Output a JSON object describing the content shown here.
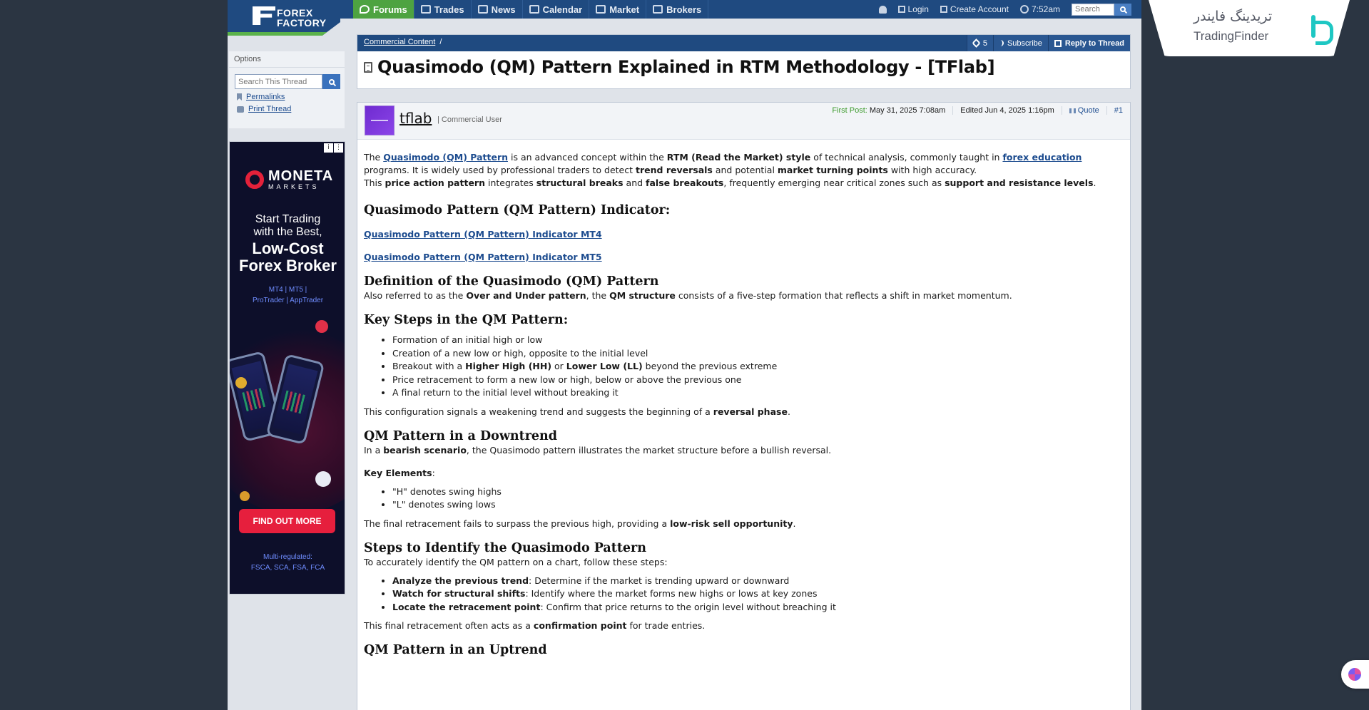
{
  "site": {
    "logo_line1": "FOREX",
    "logo_line2": "FACTORY"
  },
  "nav": {
    "tabs": [
      {
        "label": "Forums",
        "icon": "forums-icon",
        "active": true
      },
      {
        "label": "Trades",
        "icon": "trades-icon"
      },
      {
        "label": "News",
        "icon": "news-icon"
      },
      {
        "label": "Calendar",
        "icon": "calendar-icon"
      },
      {
        "label": "Market",
        "icon": "market-icon"
      },
      {
        "label": "Brokers",
        "icon": "brokers-icon"
      }
    ],
    "login": "Login",
    "create_account": "Create Account",
    "time": "7:52am",
    "search_placeholder": "Search"
  },
  "sidebar": {
    "options_title": "Options",
    "search_placeholder": "Search This Thread",
    "permalinks": "Permalinks",
    "print_thread": "Print Thread"
  },
  "ad": {
    "brand": "MONETA",
    "brand_sub": "MARKETS",
    "line1a": "Start Trading",
    "line1b": "with the Best,",
    "line2a": "Low-Cost",
    "line2b": "Forex Broker",
    "platforms1": "MT4 | MT5 |",
    "platforms2": "ProTrader | AppTrader",
    "cta": "FIND OUT MORE",
    "reg1": "Multi-regulated:",
    "reg2": "FSCA, SCA, FSA, FCA",
    "badge_info": "i",
    "badge_menu": "⋮"
  },
  "thread": {
    "breadcrumb": "Commercial Content",
    "breadcrumb_sep": "/",
    "tag_count": "5",
    "subscribe": "Subscribe",
    "reply": "Reply to Thread",
    "title": "Quasimodo (QM) Pattern Explained in RTM Methodology - [TFlab]"
  },
  "post": {
    "username": "tflab",
    "role_sep": "|",
    "role": "Commercial User",
    "first_post_label": "First Post:",
    "first_post_date": "May 31, 2025 7:08am",
    "edited": "Edited Jun 4, 2025 1:16pm",
    "quote": "Quote",
    "permalink_hash": "#",
    "permalink_num": "1",
    "intro": {
      "t1": "The ",
      "link1": "Quasimodo (QM) Pattern",
      "t2": " is an advanced concept within the ",
      "b1": "RTM (Read the Market) style",
      "t3": " of technical analysis, commonly taught in ",
      "link2": "forex education",
      "t4": " programs. It is widely used by professional traders to detect ",
      "b2": "trend reversals",
      "t5": " and potential ",
      "b3": "market turning points",
      "t6": " with high accuracy.",
      "t7": "This ",
      "b4": "price action pattern",
      "t8": " integrates ",
      "b5": "structural breaks",
      "t9": " and ",
      "b6": "false breakouts",
      "t10": ", frequently emerging near critical zones such as ",
      "b7": "support and resistance levels",
      "t11": "."
    },
    "h_indicator": "Quasimodo Pattern (QM Pattern) Indicator:",
    "link_mt4": "Quasimodo Pattern (QM Pattern) Indicator MT4",
    "link_mt5": "Quasimodo Pattern (QM Pattern) Indicator MT5",
    "h_definition": "Definition of the Quasimodo (QM) Pattern",
    "def": {
      "t1": "Also referred to as the ",
      "b1": "Over and Under pattern",
      "t2": ", the ",
      "b2": "QM structure",
      "t3": " consists of a five-step formation that reflects a shift in market momentum."
    },
    "h_steps": "Key Steps in the QM Pattern:",
    "steps": {
      "s1": "Formation of an initial high or low",
      "s2": "Creation of a new low or high, opposite to the initial level",
      "s3a": "Breakout with a ",
      "s3b": "Higher High (HH)",
      "s3c": " or ",
      "s3d": "Lower Low (LL)",
      "s3e": " beyond the previous extreme",
      "s4": "Price retracement to form a new low or high, below or above the previous one",
      "s5": "A final return to the initial level without breaking it"
    },
    "config": {
      "t1": "This configuration signals a weakening trend and suggests the beginning of a ",
      "b1": "reversal phase",
      "t2": "."
    },
    "h_downtrend": "QM Pattern in a Downtrend",
    "down": {
      "t1": "In a ",
      "b1": "bearish scenario",
      "t2": ", the Quasimodo pattern illustrates the market structure before a bullish reversal."
    },
    "key_elements_label": "Key Elements",
    "key_elements_colon": ":",
    "elements": {
      "e1": "\"H\" denotes swing highs",
      "e2": "\"L\" denotes swing lows"
    },
    "final": {
      "t1": "The final retracement fails to surpass the previous high, providing a ",
      "b1": "low-risk sell opportunity",
      "t2": "."
    },
    "h_identify": "Steps to Identify the Quasimodo Pattern",
    "identify_intro": "To accurately identify the QM pattern on a chart, follow these steps:",
    "identify": {
      "i1b": "Analyze the previous trend",
      "i1t": ": Determine if the market is trending upward or downward",
      "i2b": "Watch for structural shifts",
      "i2t": ": Identify where the market forms new highs or lows at key zones",
      "i3b": "Locate the retracement point",
      "i3t": ": Confirm that price returns to the origin level without breaching it"
    },
    "confirm": {
      "t1": "This final retracement often acts as a ",
      "b1": "confirmation point",
      "t2": " for trade entries."
    },
    "h_uptrend": "QM Pattern in an Uptrend"
  },
  "watermark": {
    "persian": "تریدینگ فایندر",
    "latin": "TradingFinder"
  },
  "colors": {
    "nav_blue": "#1f4a80",
    "nav_green": "#4ea341",
    "link": "#1d4c8f",
    "ad_red": "#e61f3d",
    "tf_teal": "#1ec7c3"
  }
}
